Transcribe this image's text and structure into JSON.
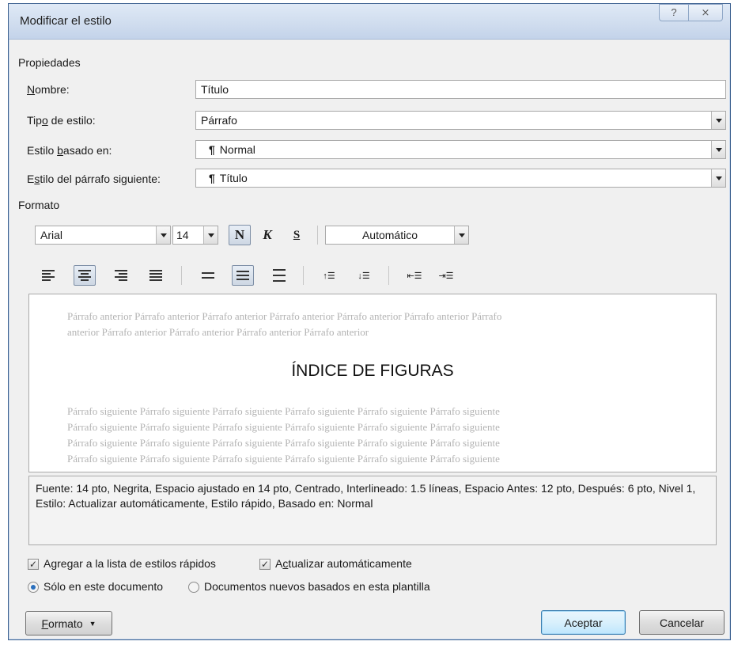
{
  "window": {
    "title": "Modificar el estilo",
    "help_label": "?",
    "close_label": "⨯"
  },
  "propiedades": {
    "section_label": "Propiedades",
    "nombre": {
      "label": "Nombre:",
      "value": "Título"
    },
    "tipo": {
      "label": "Tipo de estilo:",
      "value": "Párrafo"
    },
    "basado": {
      "label": "Estilo basado en:",
      "value": "Normal"
    },
    "siguiente": {
      "label": "Estilo del párrafo siguiente:",
      "value": "Título"
    }
  },
  "formato": {
    "section_label": "Formato",
    "font": "Arial",
    "size": "14",
    "bold_label": "N",
    "italic_label": "K",
    "underline_label": "S",
    "color": "Automático"
  },
  "preview": {
    "previous": [
      "Párrafo anterior Párrafo anterior Párrafo anterior Párrafo anterior Párrafo anterior Párrafo anterior Párrafo",
      "anterior Párrafo anterior Párrafo anterior Párrafo anterior Párrafo anterior"
    ],
    "title": "ÍNDICE DE FIGURAS",
    "following": [
      "Párrafo siguiente Párrafo siguiente Párrafo siguiente Párrafo siguiente Párrafo siguiente Párrafo siguiente",
      "Párrafo siguiente Párrafo siguiente Párrafo siguiente Párrafo siguiente Párrafo siguiente Párrafo siguiente",
      "Párrafo siguiente Párrafo siguiente Párrafo siguiente Párrafo siguiente Párrafo siguiente Párrafo siguiente",
      "Párrafo siguiente Párrafo siguiente Párrafo siguiente Párrafo siguiente Párrafo siguiente Párrafo siguiente"
    ]
  },
  "description": "Fuente: 14 pto, Negrita, Espacio ajustado en 14 pto, Centrado, Interlineado:  1.5 líneas, Espacio Antes:  12 pto, Después:  6 pto, Nivel 1, Estilo: Actualizar automáticamente, Estilo rápido, Basado en: Normal",
  "options": {
    "add_quick": {
      "label": "Agregar a la lista de estilos rápidos",
      "checked": true
    },
    "auto_update": {
      "label": "Actualizar automáticamente",
      "checked": true
    },
    "only_doc": {
      "label": "Sólo en este documento",
      "selected": true
    },
    "new_docs": {
      "label": "Documentos nuevos basados en esta plantilla",
      "selected": false
    }
  },
  "buttons": {
    "formato": "Formato",
    "aceptar": "Aceptar",
    "cancelar": "Cancelar"
  }
}
